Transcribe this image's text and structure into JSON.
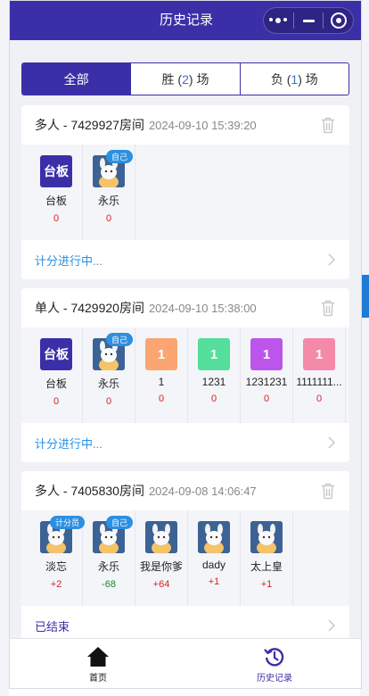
{
  "header": {
    "title": "历史记录"
  },
  "tabs": [
    {
      "label": "全部",
      "active": true
    },
    {
      "prefix": "胜 (",
      "count": "2",
      "suffix": ") 场"
    },
    {
      "prefix": "负 (",
      "count": "1",
      "suffix": ") 场"
    }
  ],
  "records": [
    {
      "room": "多人 - 7429927房间",
      "time": "2024-09-10 15:39:20",
      "status": "计分进行中...",
      "players": [
        {
          "name": "台板",
          "avatar_text": "台板",
          "score": "0"
        },
        {
          "name": "永乐",
          "badge": "自己",
          "score": "0"
        }
      ]
    },
    {
      "room": "单人 - 7429920房间",
      "time": "2024-09-10 15:38:00",
      "status": "计分进行中...",
      "players": [
        {
          "name": "台板",
          "avatar_text": "台板",
          "score": "0"
        },
        {
          "name": "永乐",
          "badge": "自己",
          "score": "0"
        },
        {
          "name": "1",
          "avatar_text": "1",
          "score": "0"
        },
        {
          "name": "1231",
          "avatar_text": "1",
          "score": "0"
        },
        {
          "name": "1231231",
          "avatar_text": "1",
          "score": "0"
        },
        {
          "name": "1111111...",
          "avatar_text": "1",
          "score": "0"
        }
      ]
    },
    {
      "room": "多人 - 7405830房间",
      "time": "2024-09-08 14:06:47",
      "status": "已结束",
      "players": [
        {
          "name": "淡忘",
          "badge": "计分员",
          "score": "+2"
        },
        {
          "name": "永乐",
          "badge": "自己",
          "score": "-68"
        },
        {
          "name": "我是你爹",
          "score": "+64"
        },
        {
          "name": "dady",
          "score": "+1"
        },
        {
          "name": "太上皇",
          "score": "+1"
        }
      ]
    }
  ],
  "tabbar": [
    {
      "label": "首页",
      "icon": "home-icon"
    },
    {
      "label": "历史记录",
      "icon": "history-icon",
      "active": true
    }
  ],
  "colors": {
    "brand": "#3b2fa8",
    "link": "#2d8fe0",
    "positive": "#e02020",
    "negative": "#1a8a2a",
    "avatar_orange": "#fba572",
    "avatar_green": "#55de9c",
    "avatar_violet": "#bb55ec",
    "avatar_pink": "#f58aa8"
  }
}
